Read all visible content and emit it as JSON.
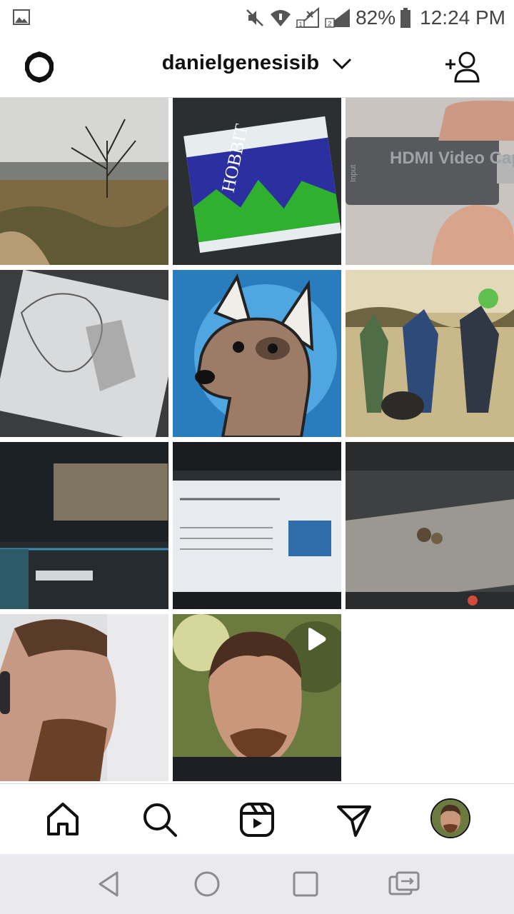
{
  "status_bar": {
    "battery_percent": "82%",
    "time": "12:24 PM",
    "icons": [
      "image-notification-icon",
      "mute-icon",
      "wifi-icon",
      "signal-sim1-icon",
      "signal-sim2-icon",
      "battery-icon"
    ]
  },
  "header": {
    "username": "danielgenesisib",
    "icons": [
      "settings-gear-icon",
      "chevron-down-icon",
      "add-user-icon"
    ]
  },
  "grid": {
    "posts": [
      {
        "name": "post-landscape-tree",
        "type": "photo"
      },
      {
        "name": "post-hobbit-book",
        "type": "photo"
      },
      {
        "name": "post-hdmi-capture",
        "type": "photo",
        "text": "HDMI Video Capture",
        "side_text": "Input"
      },
      {
        "name": "post-sketch-drawing",
        "type": "photo"
      },
      {
        "name": "post-dog-logo",
        "type": "photo"
      },
      {
        "name": "post-fallout-art",
        "type": "photo"
      },
      {
        "name": "post-video-editor",
        "type": "photo"
      },
      {
        "name": "post-browser-screen",
        "type": "photo"
      },
      {
        "name": "post-game-screen",
        "type": "photo"
      },
      {
        "name": "post-selfie-1",
        "type": "photo"
      },
      {
        "name": "post-selfie-reel",
        "type": "reel"
      }
    ]
  },
  "bottom_nav": {
    "items": [
      "home-icon",
      "search-icon",
      "reels-icon",
      "direct-messages-icon",
      "profile-avatar"
    ]
  },
  "colors": {
    "header_border": "#dbdbdb",
    "icon_dark": "#111111",
    "android_nav_bg": "#e9e9ee"
  }
}
